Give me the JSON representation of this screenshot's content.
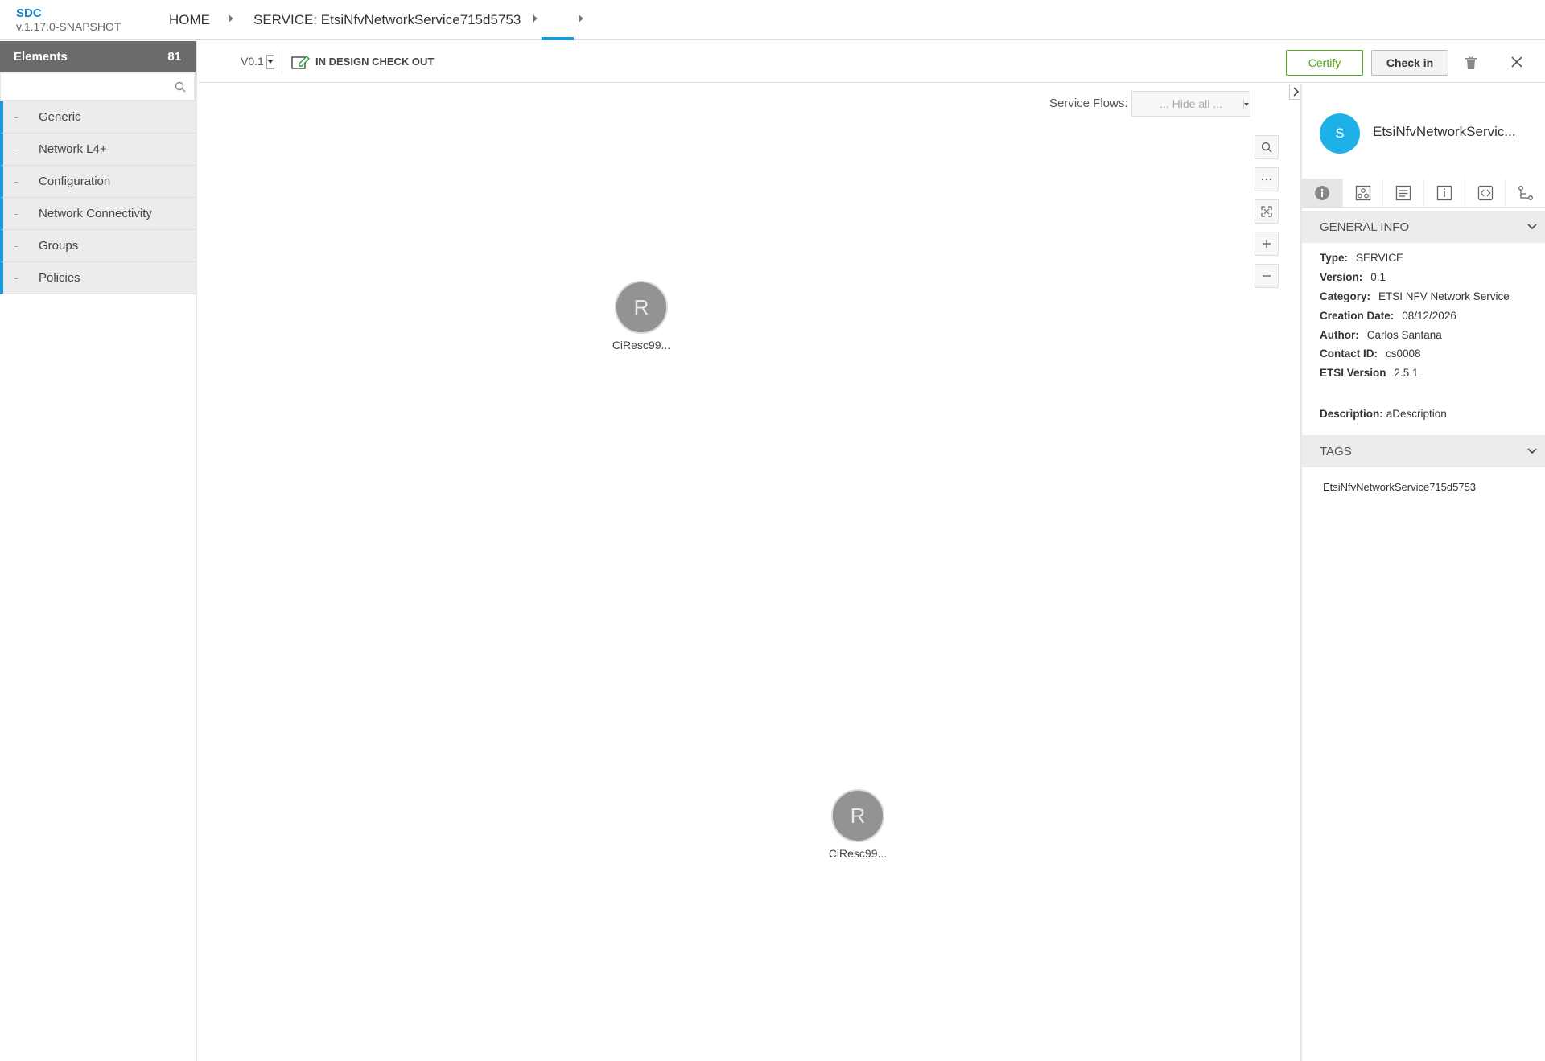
{
  "header": {
    "brand": "SDC",
    "version": "v.1.17.0-SNAPSHOT",
    "breadcrumb": [
      "HOME",
      "SERVICE: EtsiNfvNetworkService715d5753",
      ""
    ]
  },
  "left_panel": {
    "title": "Elements",
    "count": "81",
    "search_placeholder": "",
    "categories": [
      "Generic",
      "Network L4+",
      "Configuration",
      "Network Connectivity",
      "Groups",
      "Policies"
    ],
    "collapse_marker": "-"
  },
  "toolbar": {
    "version": "V0.1",
    "state": "IN DESIGN CHECK OUT",
    "certify_label": "Certify",
    "checkin_label": "Check in"
  },
  "canvas": {
    "service_flows_label": "Service Flows:",
    "service_flows_value": "... Hide all ...",
    "nodes": [
      {
        "initial": "R",
        "label": "CiResc99..."
      },
      {
        "initial": "R",
        "label": "CiResc99..."
      }
    ],
    "zoom_controls": [
      "search-icon",
      "more-icon",
      "fit-icon",
      "zoom-in-icon",
      "zoom-out-icon"
    ]
  },
  "right_panel": {
    "avatar_initial": "S",
    "title": "EtsiNfvNetworkServic...",
    "tabs": [
      "info-icon",
      "composition-icon",
      "deployment-icon",
      "properties-icon",
      "api-icon",
      "relations-icon"
    ],
    "general_info_title": "GENERAL INFO",
    "general_info": [
      {
        "label": "Type:",
        "value": "SERVICE"
      },
      {
        "label": "Version:",
        "value": "0.1"
      },
      {
        "label": "Category:",
        "value": "ETSI NFV Network Service"
      },
      {
        "label": "Creation Date:",
        "value": "08/12/2026"
      },
      {
        "label": "Author:",
        "value": "Carlos Santana"
      },
      {
        "label": "Contact ID:",
        "value": "cs0008"
      },
      {
        "label": "ETSI Version",
        "value": "2.5.1"
      }
    ],
    "description_label": "Description:",
    "description_value": "aDescription",
    "tags_title": "TAGS",
    "tags": [
      "EtsiNfvNetworkService715d5753"
    ]
  },
  "colors": {
    "accent": "#1a9ad8",
    "certify": "#4ca90c",
    "avatar": "#1eb1e8",
    "node": "#939393",
    "elements_header": "#6b6b6b"
  }
}
